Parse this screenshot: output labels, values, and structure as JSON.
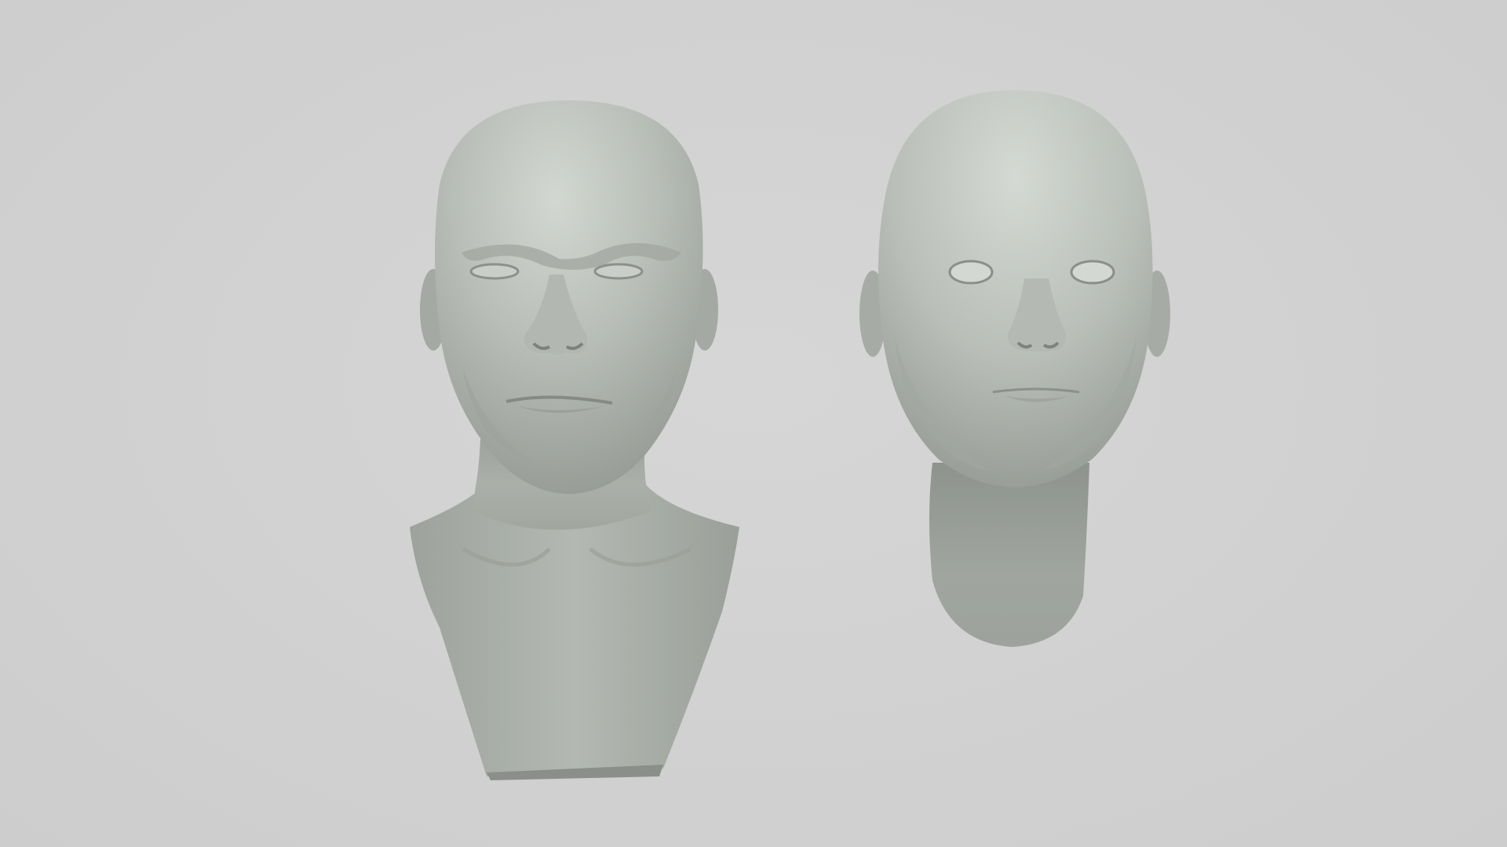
{
  "scene": {
    "background_color": "#d3d3d3",
    "sculpt_color": "#b3b8b2",
    "objects": [
      {
        "id": "male-bust",
        "description_icon": "head-bust-icon"
      },
      {
        "id": "female-head",
        "description_icon": "head-icon"
      }
    ]
  }
}
